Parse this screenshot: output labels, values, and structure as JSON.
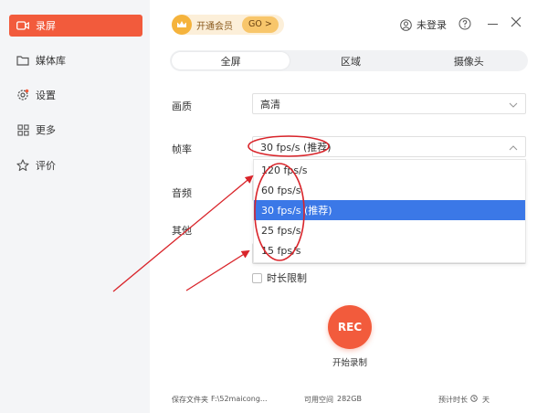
{
  "sidebar": {
    "items": [
      {
        "label": "录屏",
        "icon": "video-camera-icon",
        "active": true
      },
      {
        "label": "媒体库",
        "icon": "folder-icon"
      },
      {
        "label": "设置",
        "icon": "gear-icon"
      },
      {
        "label": "更多",
        "icon": "grid-icon"
      },
      {
        "label": "评价",
        "icon": "star-icon"
      }
    ]
  },
  "topbar": {
    "vip_label": "开通会员",
    "vip_go": "GO >",
    "login_label": "未登录"
  },
  "tabs": [
    "全屏",
    "区域",
    "摄像头"
  ],
  "settings": {
    "quality_label": "画质",
    "quality_value": "高清",
    "framerate_label": "帧率",
    "framerate_value": "30 fps/s (推荐)",
    "audio_label": "音频",
    "other_label": "其他",
    "duration_limit_label": "时长限制"
  },
  "framerate_options": [
    {
      "label": "120 fps/s"
    },
    {
      "label": "60 fps/s"
    },
    {
      "label": "30 fps/s (推荐)",
      "selected": true
    },
    {
      "label": "25 fps/s"
    },
    {
      "label": "15 fps/s"
    }
  ],
  "record": {
    "button_label": "REC",
    "caption": "开始录制"
  },
  "footer": {
    "save_folder_label": "保存文件夹",
    "save_folder_path": "F:\\52maicong...",
    "free_space_label": "可用空间",
    "free_space_value": "282GB",
    "extra_label": "预计时长",
    "extra_value": "天"
  },
  "colors": {
    "accent": "#f25b3c",
    "selection": "#3b78e7",
    "annotation": "#d9242a",
    "sidebar_bg": "#f4f5f7"
  }
}
